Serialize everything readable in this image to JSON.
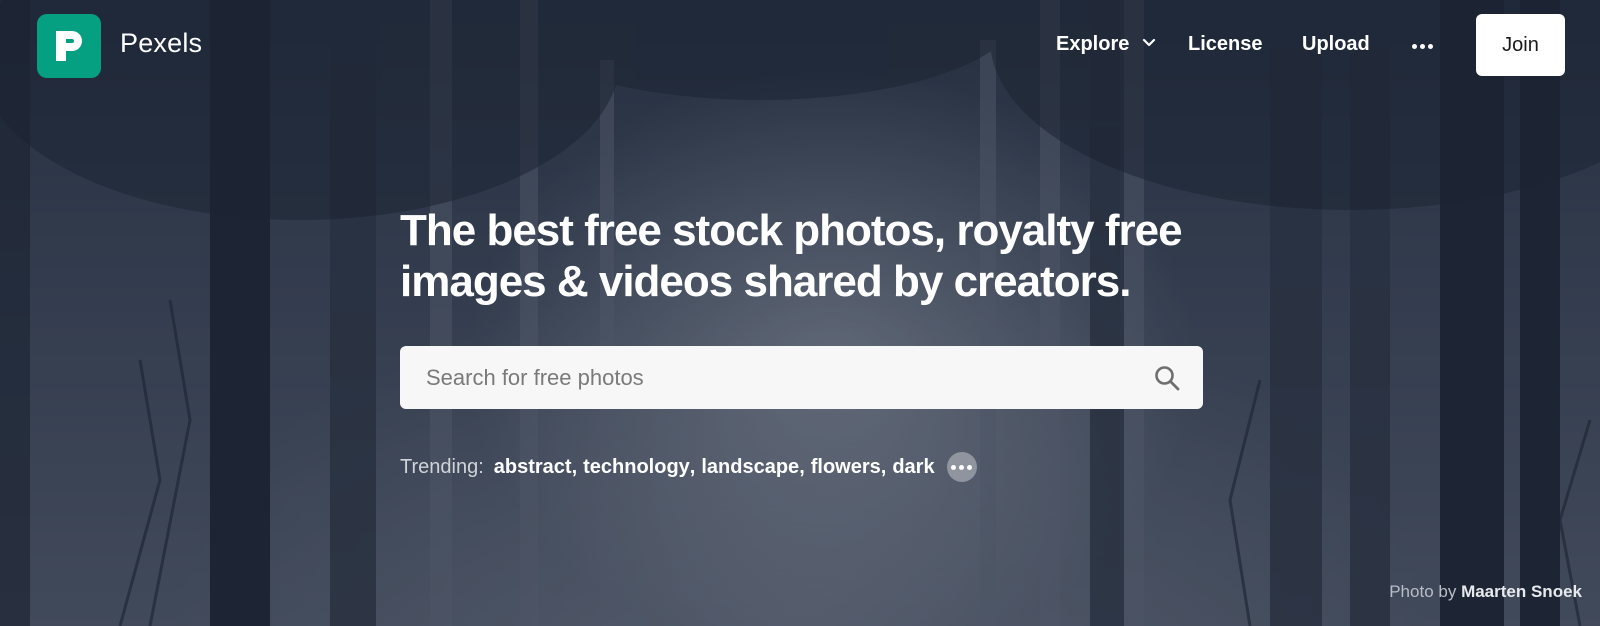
{
  "brand": {
    "name": "Pexels",
    "accent_color": "#05a081"
  },
  "nav": {
    "explore_label": "Explore",
    "license_label": "License",
    "upload_label": "Upload",
    "more_icon": "ellipsis-icon",
    "join_label": "Join"
  },
  "hero": {
    "headline_line1": "The best free stock photos, royalty free",
    "headline_line2": "images & videos shared by creators."
  },
  "search": {
    "placeholder": "Search for free photos",
    "value": ""
  },
  "trending": {
    "label": "Trending:",
    "items": [
      "abstract",
      "technology",
      "landscape",
      "flowers",
      "dark"
    ]
  },
  "credit": {
    "prefix": "Photo by",
    "author": "Maarten Snoek"
  }
}
